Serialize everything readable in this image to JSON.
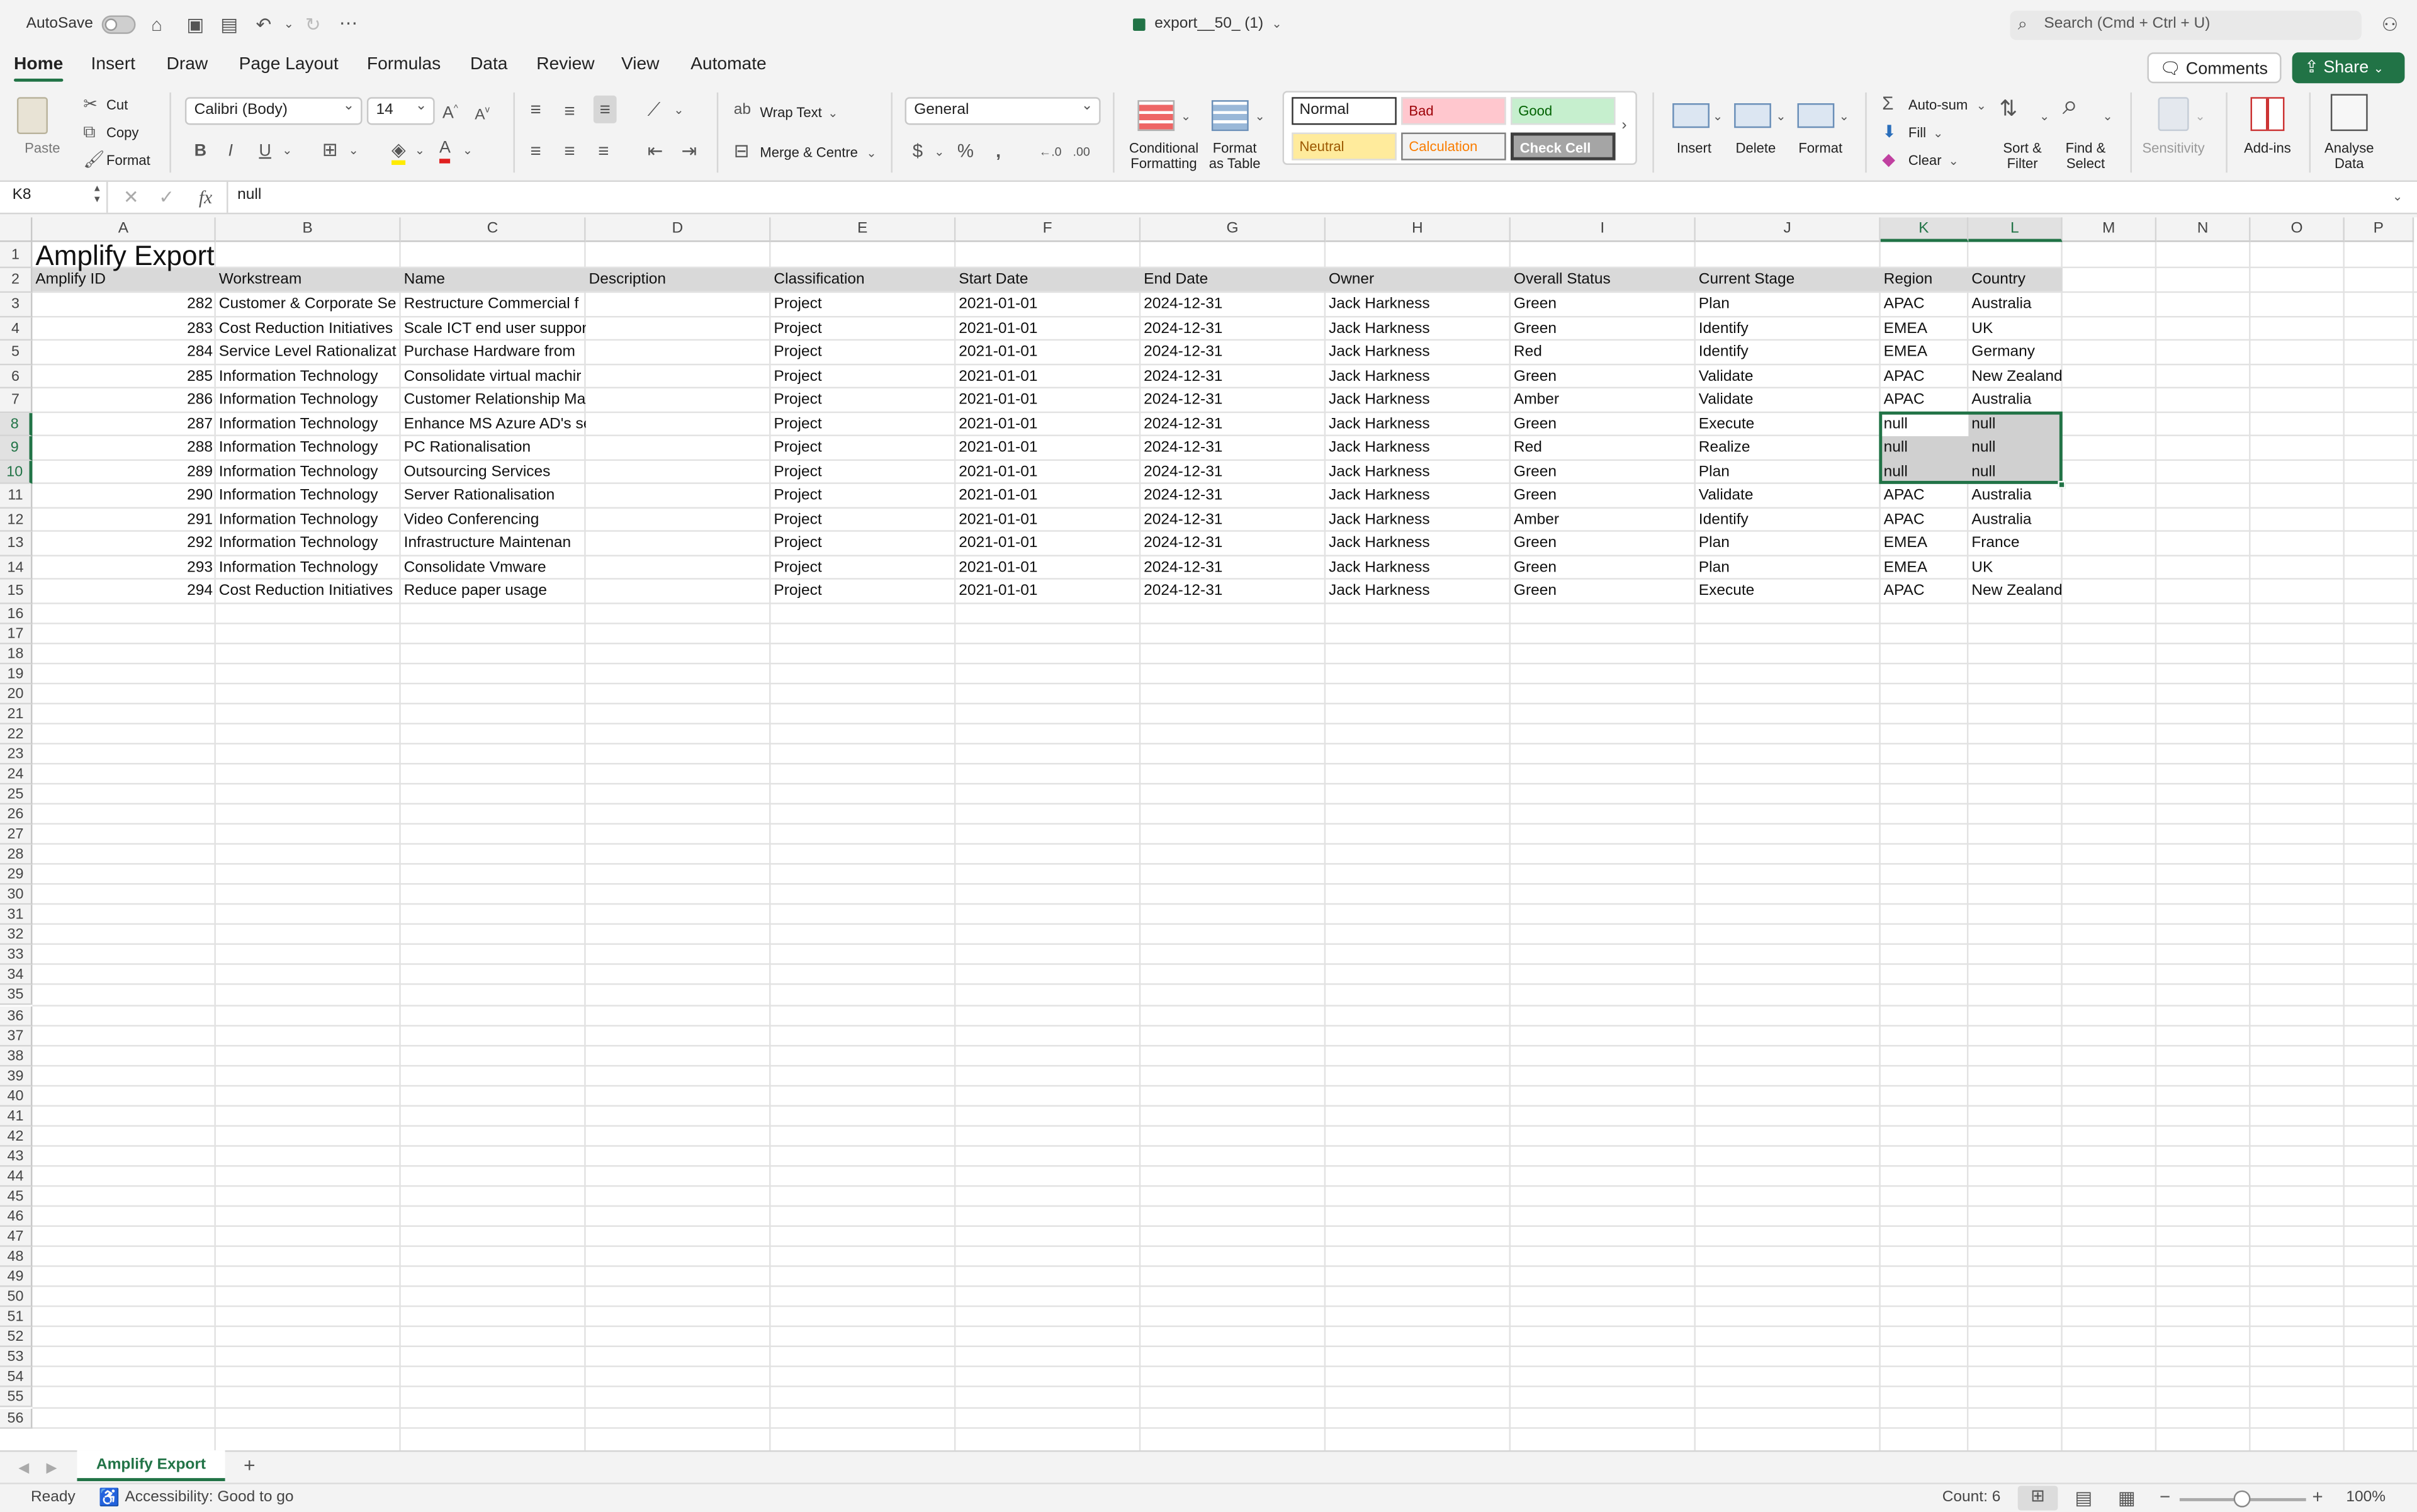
{
  "titlebar": {
    "autosave_label": "AutoSave",
    "file_name": "export__50_ (1)",
    "search_placeholder": "Search (Cmd + Ctrl + U)"
  },
  "menu_tabs": [
    "Home",
    "Insert",
    "Draw",
    "Page Layout",
    "Formulas",
    "Data",
    "Review",
    "View",
    "Automate"
  ],
  "active_tab": "Home",
  "header_buttons": {
    "comments": "Comments",
    "share": "Share"
  },
  "ribbon": {
    "paste": "Paste",
    "cut": "Cut",
    "copy": "Copy",
    "format_painter": "Format",
    "font_name": "Calibri (Body)",
    "font_size": "14",
    "wrap_text": "Wrap Text",
    "merge_centre": "Merge & Centre",
    "number_format": "General",
    "conditional_formatting": "Conditional Formatting",
    "format_as_table": "Format as Table",
    "styles": {
      "normal": "Normal",
      "bad": "Bad",
      "good": "Good",
      "neutral": "Neutral",
      "calculation": "Calculation",
      "check_cell": "Check Cell"
    },
    "insert": "Insert",
    "delete": "Delete",
    "format": "Format",
    "autosum": "Auto-sum",
    "fill": "Fill",
    "clear": "Clear",
    "sort_filter": "Sort & Filter",
    "find_select": "Find & Select",
    "sensitivity": "Sensitivity",
    "addins": "Add-ins",
    "analyse_data": "Analyse Data"
  },
  "formula_bar": {
    "name_box": "K8",
    "fx": "fx",
    "value": "null"
  },
  "columns": [
    "A",
    "B",
    "C",
    "D",
    "E",
    "F",
    "G",
    "H",
    "I",
    "J",
    "K",
    "L",
    "M",
    "N",
    "O",
    "P"
  ],
  "selected_columns": [
    "K",
    "L"
  ],
  "selected_rows": [
    8,
    9,
    10
  ],
  "sheet_title": "Amplify Export",
  "table_headers": [
    "Amplify ID",
    "Workstream",
    "Name",
    "Description",
    "Classification",
    "Start Date",
    "End Date",
    "Owner",
    "Overall Status",
    "Current Stage",
    "Region",
    "Country"
  ],
  "table_rows": [
    [
      "282",
      "Customer & Corporate Se",
      "Restructure Commercial f",
      "",
      "Project",
      "2021-01-01",
      "2024-12-31",
      "Jack Harkness",
      "Green",
      "Plan",
      "APAC",
      "Australia"
    ],
    [
      "283",
      "Cost Reduction Initiatives",
      "Scale ICT end user support",
      "",
      "Project",
      "2021-01-01",
      "2024-12-31",
      "Jack Harkness",
      "Green",
      "Identify",
      "EMEA",
      "UK"
    ],
    [
      "284",
      "Service Level Rationalizat",
      "Purchase Hardware from",
      "",
      "Project",
      "2021-01-01",
      "2024-12-31",
      "Jack Harkness",
      "Red",
      "Identify",
      "EMEA",
      "Germany"
    ],
    [
      "285",
      "Information Technology",
      "Consolidate virtual machir",
      "",
      "Project",
      "2021-01-01",
      "2024-12-31",
      "Jack Harkness",
      "Green",
      "Validate",
      "APAC",
      "New Zealand"
    ],
    [
      "286",
      "Information Technology",
      "Customer Relationship Ma",
      "",
      "Project",
      "2021-01-01",
      "2024-12-31",
      "Jack Harkness",
      "Amber",
      "Validate",
      "APAC",
      "Australia"
    ],
    [
      "287",
      "Information Technology",
      "Enhance MS Azure AD's se",
      "",
      "Project",
      "2021-01-01",
      "2024-12-31",
      "Jack Harkness",
      "Green",
      "Execute",
      "null",
      "null"
    ],
    [
      "288",
      "Information Technology",
      "PC Rationalisation",
      "",
      "Project",
      "2021-01-01",
      "2024-12-31",
      "Jack Harkness",
      "Red",
      "Realize",
      "null",
      "null"
    ],
    [
      "289",
      "Information Technology",
      "Outsourcing Services",
      "",
      "Project",
      "2021-01-01",
      "2024-12-31",
      "Jack Harkness",
      "Green",
      "Plan",
      "null",
      "null"
    ],
    [
      "290",
      "Information Technology",
      "Server Rationalisation",
      "",
      "Project",
      "2021-01-01",
      "2024-12-31",
      "Jack Harkness",
      "Green",
      "Validate",
      "APAC",
      "Australia"
    ],
    [
      "291",
      "Information Technology",
      "Video Conferencing",
      "",
      "Project",
      "2021-01-01",
      "2024-12-31",
      "Jack Harkness",
      "Amber",
      "Identify",
      "APAC",
      "Australia"
    ],
    [
      "292",
      "Information Technology",
      "Infrastructure Maintenan",
      "",
      "Project",
      "2021-01-01",
      "2024-12-31",
      "Jack Harkness",
      "Green",
      "Plan",
      "EMEA",
      "France"
    ],
    [
      "293",
      "Information Technology",
      "Consolidate Vmware",
      "",
      "Project",
      "2021-01-01",
      "2024-12-31",
      "Jack Harkness",
      "Green",
      "Plan",
      "EMEA",
      "UK"
    ],
    [
      "294",
      "Cost Reduction Initiatives",
      "Reduce paper usage",
      "",
      "Project",
      "2021-01-01",
      "2024-12-31",
      "Jack Harkness",
      "Green",
      "Execute",
      "APAC",
      "New Zealand"
    ]
  ],
  "row_count": 56,
  "sheet_tab": "Amplify Export",
  "status": {
    "ready": "Ready",
    "accessibility": "Accessibility: Good to go",
    "count": "Count: 6",
    "zoom": "100%"
  },
  "colors": {
    "accent": "#217346",
    "selection_fill": "#d0d0d0",
    "header_fill": "#d9d9d9"
  }
}
